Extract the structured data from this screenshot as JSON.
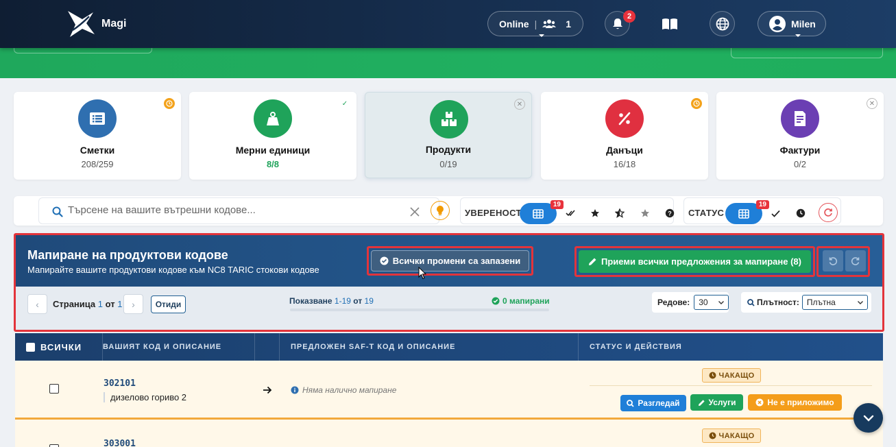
{
  "app": {
    "name": "Magi"
  },
  "header": {
    "online_label": "Online",
    "online_count": "1",
    "notifications_count": "2",
    "user_name": "Milen"
  },
  "steps": [
    {
      "title": "Сметки",
      "value": "208/259",
      "state": "pending",
      "color": "#2f6fb0"
    },
    {
      "title": "Мерни единици",
      "value": "8/8",
      "state": "done",
      "color": "#1fa35a"
    },
    {
      "title": "Продукти",
      "value": "0/19",
      "state": "not-started",
      "color": "#1fa35a",
      "active": true
    },
    {
      "title": "Данъци",
      "value": "16/18",
      "state": "pending",
      "color": "#e03040"
    },
    {
      "title": "Фактури",
      "value": "0/2",
      "state": "not-started",
      "color": "#6b3fb3"
    }
  ],
  "filters": {
    "search_placeholder": "Търсене на вашите вътрешни кодове...",
    "confidence_label": "УВЕРЕНОСТ",
    "confidence_badge": "19",
    "status_label": "СТАТУС",
    "status_badge": "19"
  },
  "mapping": {
    "title": "Мапиране на продуктови кодове",
    "subtitle": "Мапирайте вашите продуктови кодове към NC8 TARIC стокови кодове",
    "saved_label": "Всички промени са запазени",
    "accept_label": "Приеми всички предложения за мапиране (8)",
    "page_label": "Страница",
    "page_current": "1",
    "page_of": "от",
    "page_total": "1",
    "skip_label": "Отиди",
    "showing_label": "Показване",
    "showing_range": "1-19",
    "showing_of": "от",
    "showing_total": "19",
    "mapped_label": "0 мапирани",
    "mapped_progress": 0,
    "rows_label": "Редове:",
    "rows_value": "30",
    "density_label": "Плътност:",
    "density_value": "Плътна"
  },
  "table": {
    "headers": {
      "all": "ВСИЧКИ",
      "your_code": "ВАШИЯТ КОД И ОПИСАНИЕ",
      "suggested": "ПРЕДЛОЖЕН SAF-T КОД И ОПИСАНИЕ",
      "status": "СТАТУС И ДЕЙСТВИЯ"
    },
    "rows": [
      {
        "code": "302101",
        "description": "дизелово гориво 2",
        "mapping": "Няма налично мапиране",
        "status": "ЧАКАЩО",
        "actions": {
          "view": "Разгледай",
          "services": "Услуги",
          "na": "Не е приложимо"
        }
      },
      {
        "code": "303001",
        "status": "ЧАКАЩО"
      }
    ]
  }
}
